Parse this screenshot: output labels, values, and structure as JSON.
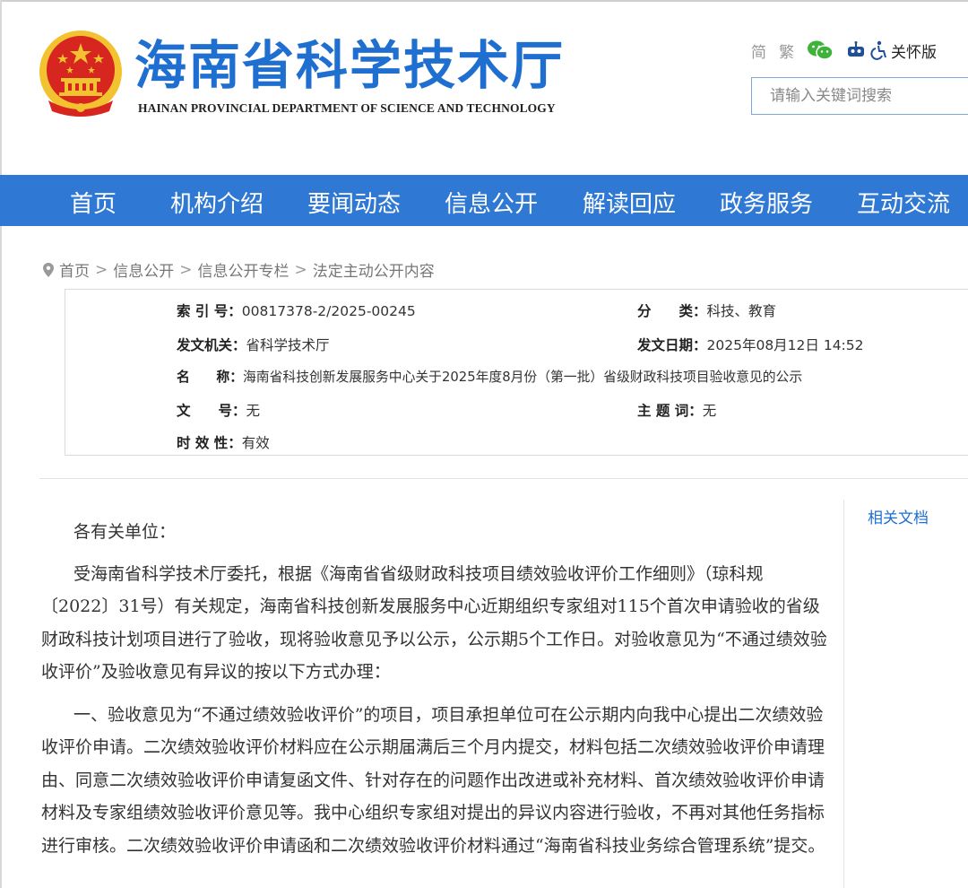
{
  "header": {
    "title_cn": "海南省科学技术厅",
    "title_en": "HAINAN PROVINCIAL DEPARTMENT OF SCIENCE AND TECHNOLOGY",
    "lang_simplified": "简",
    "lang_traditional": "繁",
    "care_label": "关怀版",
    "search_placeholder": "请输入关键词搜索"
  },
  "nav": {
    "items": [
      "首页",
      "机构介绍",
      "要闻动态",
      "信息公开",
      "解读回应",
      "政务服务",
      "互动交流"
    ]
  },
  "breadcrumb": {
    "items": [
      "首页",
      "信息公开",
      "信息公开专栏",
      "法定主动公开内容"
    ],
    "separator": ">"
  },
  "meta": {
    "index_label": "索 引 号：",
    "index_value": "00817378-2/2025-00245",
    "category_label": "分　　类：",
    "category_value": "科技、教育",
    "issuer_label": "发文机关：",
    "issuer_value": "省科学技术厅",
    "date_label": "发文日期：",
    "date_value": "2025年08月12日 14:52",
    "name_label": "名　　称：",
    "name_value": "海南省科技创新发展服务中心关于2025年度8月份（第一批）省级财政科技项目验收意见的公示",
    "docno_label": "文　　号：",
    "docno_value": "无",
    "subject_label": "主 题 词：",
    "subject_value": "无",
    "validity_label": "时 效 性：",
    "validity_value": "有效"
  },
  "side": {
    "title": "相关文档"
  },
  "article": {
    "greeting": "各有关单位：",
    "para1": "受海南省科学技术厅委托，根据《海南省省级财政科技项目绩效验收评价工作细则》（琼科规〔2022〕31号）有关规定，海南省科技创新发展服务中心近期组织专家组对115个首次申请验收的省级财政科技计划项目进行了验收，现将验收意见予以公示，公示期5个工作日。对验收意见为“不通过绩效验收评价”及验收意见有异议的按以下方式办理：",
    "para2": "一、验收意见为“不通过绩效验收评价”的项目，项目承担单位可在公示期内向我中心提出二次绩效验收评价申请。二次绩效验收评价材料应在公示期届满后三个月内提交，材料包括二次绩效验收评价申请理由、同意二次绩效验收评价申请复函文件、针对存在的问题作出改进或补充材料、首次绩效验收评价申请材料及专家组绩效验收评价意见等。我中心组织专家组对提出的异议内容进行验收，不再对其他任务指标进行审核。二次绩效验收评价申请函和二次绩效验收评价材料通过“海南省科技业务综合管理系统”提交。"
  },
  "colors": {
    "brand_blue": "#1f6fd0",
    "nav_bg": "#2f78d4",
    "emblem_red": "#d7261f",
    "emblem_gold": "#f2c230"
  }
}
